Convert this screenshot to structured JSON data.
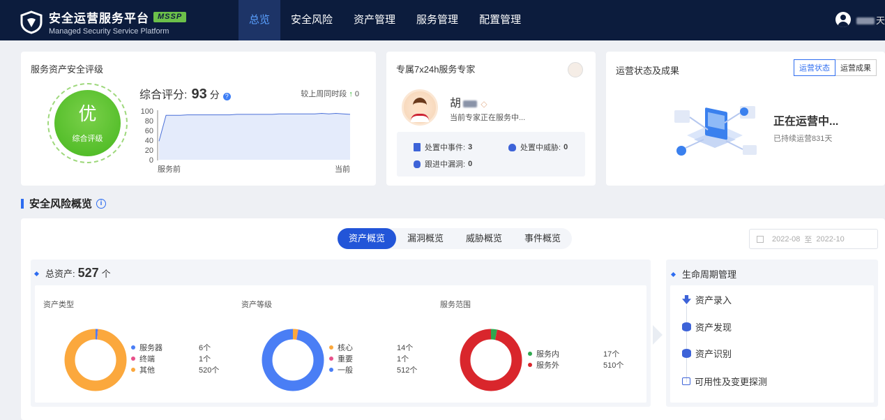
{
  "header": {
    "title": "安全运营服务平台",
    "badge": "MSSP",
    "subtitle": "Managed Security Service Platform",
    "nav": [
      "总览",
      "安全风险",
      "资产管理",
      "服务管理",
      "配置管理"
    ],
    "user_suffix": "天"
  },
  "rating": {
    "title": "服务资产安全评级",
    "grade": "优",
    "grade_label": "综合评级",
    "score_label": "综合评分:",
    "score": "93",
    "score_unit": "分",
    "compare_label": "较上周同时段",
    "compare_value": "0",
    "y_ticks": [
      "100",
      "80",
      "60",
      "40",
      "20",
      "0"
    ],
    "x_start": "服务前",
    "x_end": "当前",
    "trend": [
      38,
      91,
      91,
      91,
      92,
      92,
      92,
      92,
      92,
      92,
      92,
      93,
      93,
      93,
      93,
      93,
      93,
      94,
      94,
      94,
      94,
      94,
      94,
      95,
      94,
      95,
      94,
      93
    ]
  },
  "expert": {
    "title": "专属7x24h服务专家",
    "name": "胡",
    "status": "当前专家正在服务中...",
    "stats": [
      {
        "label": "处置中事件:",
        "value": "3"
      },
      {
        "label": "处置中威胁:",
        "value": "0"
      },
      {
        "label": "跟进中漏洞:",
        "value": "0"
      }
    ]
  },
  "operation": {
    "title": "运营状态及成果",
    "tabs": [
      "运营状态",
      "运营成果"
    ],
    "status": "正在运营中...",
    "days": "已持续运营831天"
  },
  "risk": {
    "title": "安全风险概览",
    "tabs": [
      "资产概览",
      "漏洞概览",
      "威胁概览",
      "事件概览"
    ],
    "date_from": "2022-08",
    "date_sep": "至",
    "date_to": "2022-10",
    "total_label": "总资产:",
    "total_value": "527",
    "total_unit": "个",
    "charts": [
      {
        "title": "资产类型",
        "items": [
          {
            "label": "服务器",
            "value": "6个",
            "count": 6,
            "color": "#4a7ef5"
          },
          {
            "label": "终端",
            "value": "1个",
            "count": 1,
            "color": "#e8508a"
          },
          {
            "label": "其他",
            "value": "520个",
            "count": 520,
            "color": "#fba83d"
          }
        ]
      },
      {
        "title": "资产等级",
        "items": [
          {
            "label": "核心",
            "value": "14个",
            "count": 14,
            "color": "#fba83d"
          },
          {
            "label": "重要",
            "value": "1个",
            "count": 1,
            "color": "#e8508a"
          },
          {
            "label": "一般",
            "value": "512个",
            "count": 512,
            "color": "#4a7ef5"
          }
        ]
      },
      {
        "title": "服务范围",
        "items": [
          {
            "label": "服务内",
            "value": "17个",
            "count": 17,
            "color": "#2fa84f"
          },
          {
            "label": "服务外",
            "value": "510个",
            "count": 510,
            "color": "#d9262c"
          }
        ]
      }
    ],
    "lifecycle_title": "生命周期管理",
    "lifecycle": [
      "资产录入",
      "资产发现",
      "资产识别",
      "可用性及变更探测"
    ]
  }
}
